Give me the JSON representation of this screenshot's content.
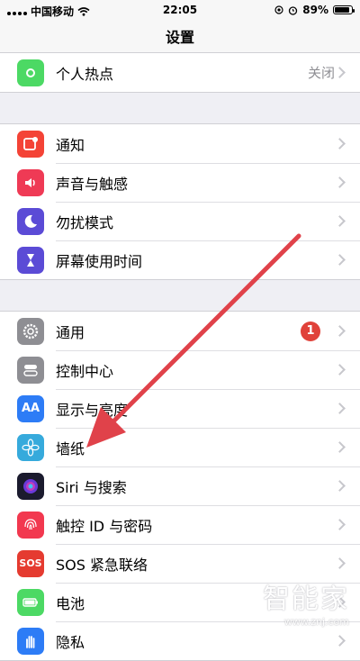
{
  "status_bar": {
    "carrier": "中国移动",
    "time": "22:05",
    "battery_text": "89%",
    "battery_level": 0.89,
    "icons": [
      "signal-icon",
      "wifi-icon",
      "location-icon",
      "alarm-icon",
      "battery-icon"
    ]
  },
  "nav": {
    "title": "设置"
  },
  "groups": [
    {
      "items": [
        {
          "label": "个人热点",
          "value": "关闭",
          "icon": "hotspot-icon",
          "color": "#4cd964"
        }
      ]
    },
    {
      "items": [
        {
          "label": "通知",
          "icon": "notifications-icon",
          "color": "#f44336"
        },
        {
          "label": "声音与触感",
          "icon": "sound-icon",
          "color": "#ef3a55"
        },
        {
          "label": "勿扰模式",
          "icon": "moon-icon",
          "color": "#5b4bd6"
        },
        {
          "label": "屏幕使用时间",
          "icon": "hourglass-icon",
          "color": "#5b4bd6"
        }
      ]
    },
    {
      "items": [
        {
          "label": "通用",
          "badge": "1",
          "icon": "gear-icon",
          "color": "#8e8e93"
        },
        {
          "label": "控制中心",
          "icon": "toggles-icon",
          "color": "#8e8e93"
        },
        {
          "label": "显示与亮度",
          "icon": "text-size-icon",
          "color": "#2d7cf6"
        },
        {
          "label": "墙纸",
          "icon": "flower-icon",
          "color": "#36aadc"
        },
        {
          "label": "Siri 与搜索",
          "icon": "siri-icon",
          "color": "#1b1b2e"
        },
        {
          "label": "触控 ID 与密码",
          "icon": "fingerprint-icon",
          "color": "#f2384f"
        },
        {
          "label": "SOS 紧急联络",
          "icon_text": "SOS",
          "icon": "sos-icon",
          "color": "#e53b30"
        },
        {
          "label": "电池",
          "icon": "battery-icon",
          "color": "#4cd964"
        },
        {
          "label": "隐私",
          "icon": "hand-icon",
          "color": "#2d7cf6"
        }
      ]
    }
  ],
  "annotation": {
    "arrow_color": "#e0424a"
  },
  "watermark": {
    "big": "智能家",
    "small": "www.znj.com"
  }
}
